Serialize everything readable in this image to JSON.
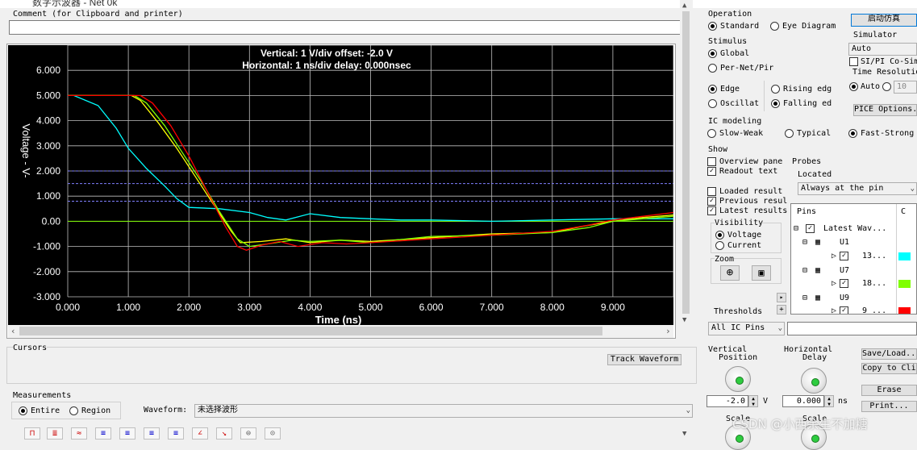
{
  "window": {
    "title": "数字示波器 - Net 0k"
  },
  "comment": {
    "label": "Comment (for Clipboard and printer)",
    "value": ""
  },
  "scope": {
    "header_line1": "Vertical: 1  V/div  offset: -2.0 V",
    "header_line2": "Horizontal: 1 ns/div  delay: 0.000nsec",
    "ylabel": "Voltage  - V-",
    "xlabel": "Time  (ns)"
  },
  "chart_data": {
    "type": "line",
    "xlabel": "Time  (ns)",
    "ylabel": "Voltage  - V-",
    "xlim": [
      0,
      10
    ],
    "ylim": [
      -3,
      7
    ],
    "x_ticks": [
      "0.000",
      "1.000",
      "2.000",
      "3.000",
      "4.000",
      "5.000",
      "6.000",
      "7.000",
      "8.000",
      "9.000"
    ],
    "y_ticks": [
      "6.000",
      "5.000",
      "4.000",
      "3.000",
      "2.000",
      "1.000",
      "0.00",
      "-1.000",
      "-2.000",
      "-3.000"
    ],
    "threshold_lines": [
      2.0,
      1.5,
      0.8
    ],
    "background": "#000000",
    "grid": true,
    "series": [
      {
        "color": "#00ffff",
        "x": [
          0,
          0.1,
          0.5,
          0.8,
          1.0,
          1.3,
          1.6,
          1.8,
          2.0,
          2.5,
          3.0,
          3.3,
          3.6,
          4.0,
          4.5,
          5.0,
          5.5,
          6.0,
          7.0,
          8.0,
          9.0,
          10.0
        ],
        "y": [
          5.0,
          5.0,
          4.6,
          3.7,
          2.9,
          2.1,
          1.4,
          0.9,
          0.55,
          0.5,
          0.35,
          0.15,
          0.05,
          0.3,
          0.15,
          0.1,
          0.05,
          0.05,
          0.0,
          0.05,
          0.1,
          0.1
        ]
      },
      {
        "color": "#ffff00",
        "x": [
          0,
          1.0,
          1.05,
          1.2,
          1.5,
          1.8,
          2.1,
          2.4,
          2.7,
          2.85,
          3.2,
          3.6,
          4.0,
          4.5,
          5.0,
          6.0,
          7.0,
          8.0,
          8.5,
          9.0,
          9.5,
          10.0
        ],
        "y": [
          5.0,
          5.0,
          5.0,
          4.8,
          3.9,
          2.9,
          1.8,
          0.7,
          -0.4,
          -0.85,
          -0.8,
          -0.7,
          -0.85,
          -0.75,
          -0.8,
          -0.65,
          -0.5,
          -0.45,
          -0.2,
          0.0,
          0.15,
          0.25
        ]
      },
      {
        "color": "#80ff00",
        "x": [
          0,
          1.1,
          1.3,
          1.6,
          1.9,
          2.2,
          2.5,
          2.8,
          3.0,
          3.3,
          3.7,
          4.0,
          4.5,
          5.0,
          6.0,
          7.0,
          8.0,
          8.6,
          9.0,
          9.5,
          10.0
        ],
        "y": [
          5.0,
          5.0,
          4.7,
          3.8,
          2.7,
          1.6,
          0.4,
          -0.7,
          -1.0,
          -0.9,
          -0.75,
          -0.8,
          -0.75,
          -0.85,
          -0.6,
          -0.55,
          -0.45,
          -0.25,
          0.0,
          0.1,
          0.2
        ]
      },
      {
        "color": "#ff0000",
        "x": [
          0,
          1.2,
          1.4,
          1.7,
          2.0,
          2.3,
          2.6,
          2.8,
          2.95,
          3.2,
          3.5,
          3.8,
          4.2,
          4.6,
          5.0,
          6.0,
          7.0,
          8.0,
          8.6,
          9.0,
          9.5,
          10.0
        ],
        "y": [
          5.0,
          5.0,
          4.7,
          3.8,
          2.6,
          1.2,
          -0.2,
          -1.0,
          -1.15,
          -0.95,
          -0.8,
          -1.0,
          -0.85,
          -0.9,
          -0.85,
          -0.7,
          -0.55,
          -0.4,
          -0.15,
          0.05,
          0.2,
          0.35
        ]
      }
    ]
  },
  "operation": {
    "title": "Operation",
    "standard": "Standard",
    "eye": "Eye Diagram",
    "start_button": "启动仿真"
  },
  "stimulus": {
    "title": "Stimulus",
    "global": "Global",
    "pernet": "Per-Net/Pir",
    "edge": "Edge",
    "oscillat": "Oscillat",
    "rising": "Rising edg",
    "falling": "Falling ed"
  },
  "simulator": {
    "title": "Simulator",
    "value": "Auto",
    "cosim": "SI/PI Co-Sim",
    "time_res": "Time Resolutio",
    "auto": "Auto",
    "time_value": "10",
    "spice_btn": "PICE Options..."
  },
  "ic_modeling": {
    "title": "IC modeling",
    "slow": "Slow-Weak",
    "typical": "Typical",
    "fast": "Fast-Strong"
  },
  "show": {
    "title": "Show",
    "overview": "Overview pane",
    "readout": "Readout text",
    "probes": "Probes",
    "located": "Located",
    "located_value": "Always at the pin",
    "loaded": "Loaded result",
    "previous": "Previous resul",
    "latest": "Latest results"
  },
  "visibility": {
    "title": "Visibility",
    "voltage": "Voltage",
    "current": "Current"
  },
  "zoom": {
    "title": "Zoom"
  },
  "thresholds": {
    "title": "Thresholds",
    "value": "All IC Pins"
  },
  "pins": {
    "header": "Pins",
    "col_c": "C",
    "root": "Latest Wav...",
    "items": [
      {
        "ref": "U1",
        "pin": "13...",
        "color": "#00ffff"
      },
      {
        "ref": "U7",
        "pin": "18...",
        "color": "#80ff00"
      },
      {
        "ref": "U9",
        "pin": "9 ...",
        "color": "#ff0000"
      }
    ]
  },
  "cursors": {
    "title": "Cursors",
    "track": "Track Waveform"
  },
  "measurements": {
    "title": "Measurements",
    "entire": "Entire",
    "region": "Region",
    "waveform_label": "Waveform:",
    "waveform_value": "未选择波形"
  },
  "vertical": {
    "title_line1": "Vertical",
    "title_line2": "Position",
    "value": "-2.0",
    "unit": "V",
    "scale": "Scale"
  },
  "horizontal": {
    "title_line1": "Horizontal",
    "title_line2": "Delay",
    "value": "0.000",
    "unit": "ns",
    "scale": "Scale"
  },
  "actions": {
    "save": "Save/Load...",
    "copy": "Copy to Cli",
    "erase": "Erase",
    "print": "Print..."
  },
  "watermark": "CSDN @小西余生不加糖"
}
